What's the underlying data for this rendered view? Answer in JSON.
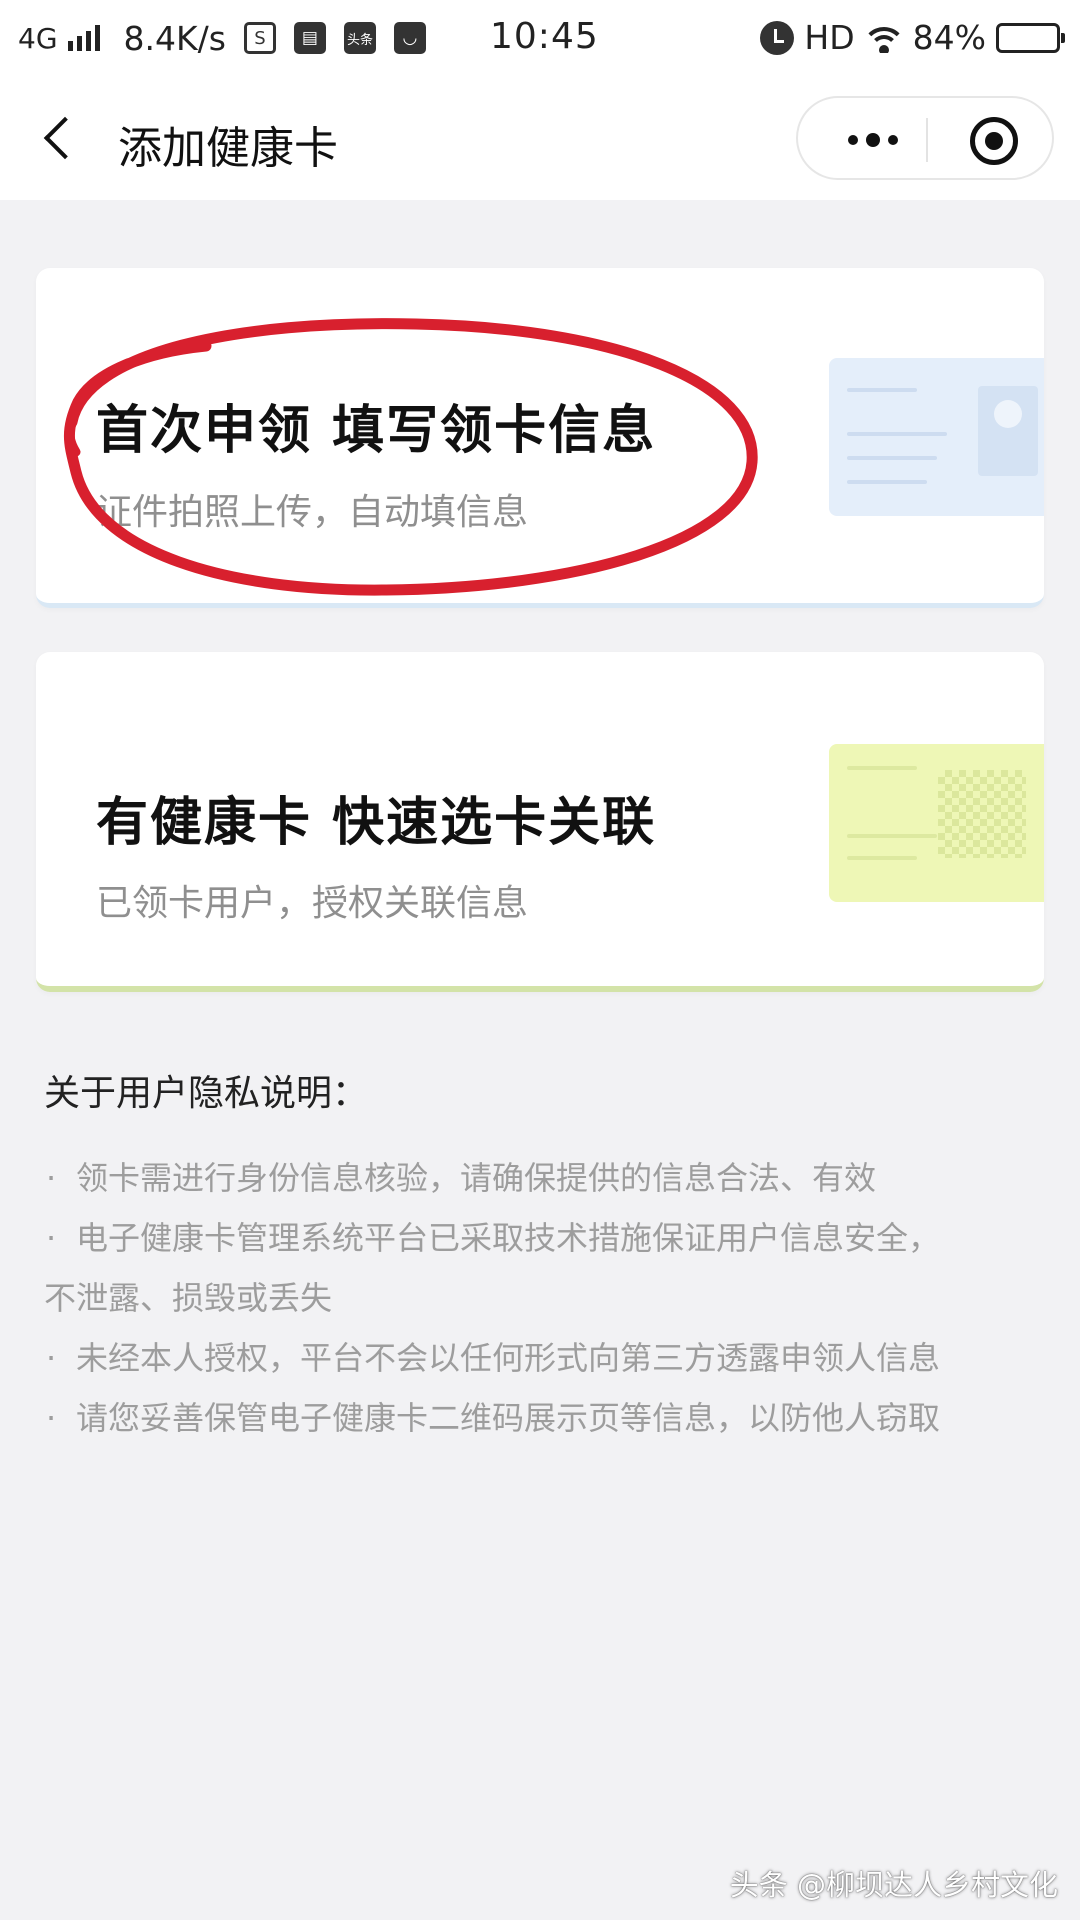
{
  "status_bar": {
    "network": "4G",
    "speed": "8.4K/s",
    "time": "10:45",
    "hd": "HD",
    "battery": "84%",
    "battery_level": 0.84,
    "icons": [
      "signal-icon",
      "sim-icon",
      "calendar-icon",
      "toutiao-icon",
      "bag-icon",
      "alarm-icon",
      "wifi-icon",
      "battery-icon"
    ],
    "app_badge": "头条"
  },
  "nav": {
    "title": "添加健康卡",
    "back_icon": "chevron-left-icon",
    "more_icon": "more-dots-icon",
    "close_icon": "target-close-icon"
  },
  "cards": [
    {
      "title": "首次申领  填写领卡信息",
      "subtitle": "证件拍照上传，自动填信息",
      "accent": "#e4eefa"
    },
    {
      "title": "有健康卡  快速选卡关联",
      "subtitle": "已领卡用户，授权关联信息",
      "accent": "#eef7b6"
    }
  ],
  "privacy": {
    "heading": "关于用户隐私说明：",
    "bullet": "·",
    "items": [
      {
        "text": "领卡需进行身份信息核验，请确保提供的信息合法、有效",
        "cont": ""
      },
      {
        "text": "电子健康卡管理系统平台已采取技术措施保证用户信息安全，",
        "cont": "不泄露、损毁或丢失"
      },
      {
        "text": "未经本人授权，平台不会以任何形式向第三方透露申领人信息",
        "cont": ""
      },
      {
        "text": "请您妥善保管电子健康卡二维码展示页等信息，以防他人窃取",
        "cont": ""
      }
    ]
  },
  "annotation_color": "#d8202e",
  "watermark": "头条 @柳坝达人乡村文化"
}
